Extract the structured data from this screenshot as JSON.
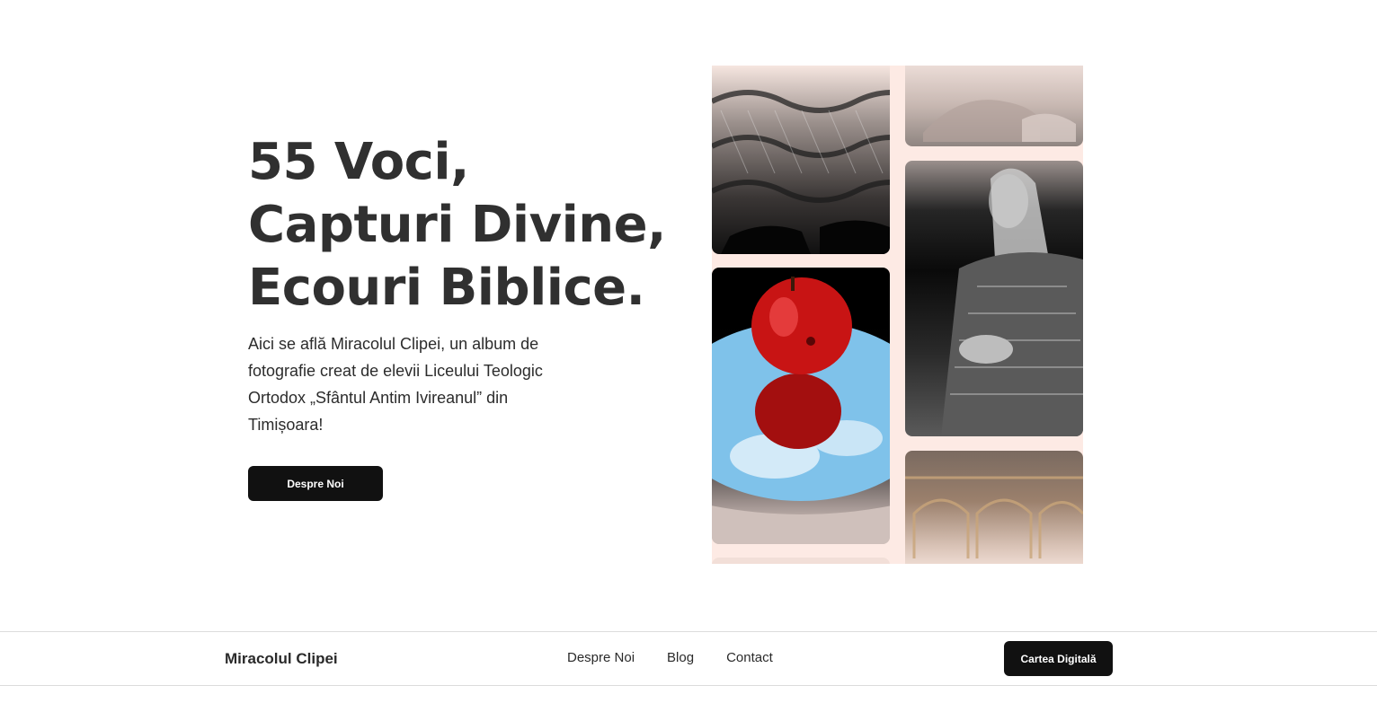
{
  "hero": {
    "headline": [
      "55 Voci,",
      "Capturi Divine,",
      "Ecouri Biblice."
    ],
    "intro": "Aici se află Miracolul Clipei, un album de fotografie creat de elevii Liceului Teologic Ortodox „Sfântul Antim Ivireanul” din Timișoara!",
    "cta_label": "Despre Noi"
  },
  "gallery": {
    "photos": [
      "chairs-photo",
      "hands-photo",
      "apple-photo",
      "woman-photo",
      "arches-photo"
    ],
    "background_color": "#fdeae4"
  },
  "navbar": {
    "brand": "Miracolul Clipei",
    "links": [
      "Despre Noi",
      "Blog",
      "Contact"
    ],
    "button_label": "Cartea Digitală"
  },
  "colors": {
    "text": "#303030",
    "button_bg": "#111111",
    "button_text": "#ffffff"
  }
}
